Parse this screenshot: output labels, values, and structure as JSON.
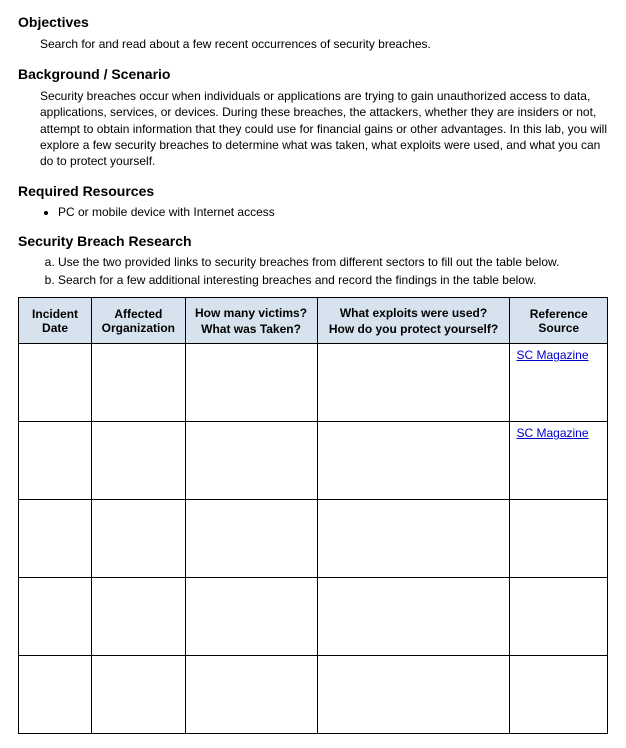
{
  "sections": {
    "objectives": {
      "heading": "Objectives",
      "text": "Search for and read about a few recent occurrences of security breaches."
    },
    "background": {
      "heading": "Background / Scenario",
      "text": "Security breaches occur when individuals or applications are trying to gain unauthorized access to data, applications, services, or devices. During these breaches, the attackers, whether they are insiders or not, attempt to obtain information that they could use for financial gains or other advantages. In this lab, you will explore a few security breaches to determine what was taken, what exploits were used, and what you can do to protect yourself."
    },
    "resources": {
      "heading": "Required Resources",
      "items": [
        "PC or mobile device with Internet access"
      ]
    },
    "research": {
      "heading": "Security Breach Research",
      "steps": [
        "Use the two provided links to security breaches from different sectors to fill out the table below.",
        "Search for a few additional interesting breaches and record the findings in the table below."
      ]
    }
  },
  "table": {
    "headers": {
      "incident_date": "Incident Date",
      "affected_org": "Affected Organization",
      "victims_line1": "How many victims?",
      "victims_line2": "What was Taken?",
      "exploits_line1": "What exploits were used?",
      "exploits_line2": "How do you protect yourself?",
      "reference": "Reference Source"
    },
    "rows": [
      {
        "incident_date": "",
        "affected_org": "",
        "victims_taken": "",
        "exploits_protect": "",
        "reference": "SC Magazine"
      },
      {
        "incident_date": "",
        "affected_org": "",
        "victims_taken": "",
        "exploits_protect": "",
        "reference": "SC Magazine"
      },
      {
        "incident_date": "",
        "affected_org": "",
        "victims_taken": "",
        "exploits_protect": "",
        "reference": ""
      },
      {
        "incident_date": "",
        "affected_org": "",
        "victims_taken": "",
        "exploits_protect": "",
        "reference": ""
      },
      {
        "incident_date": "",
        "affected_org": "",
        "victims_taken": "",
        "exploits_protect": "",
        "reference": ""
      }
    ]
  }
}
